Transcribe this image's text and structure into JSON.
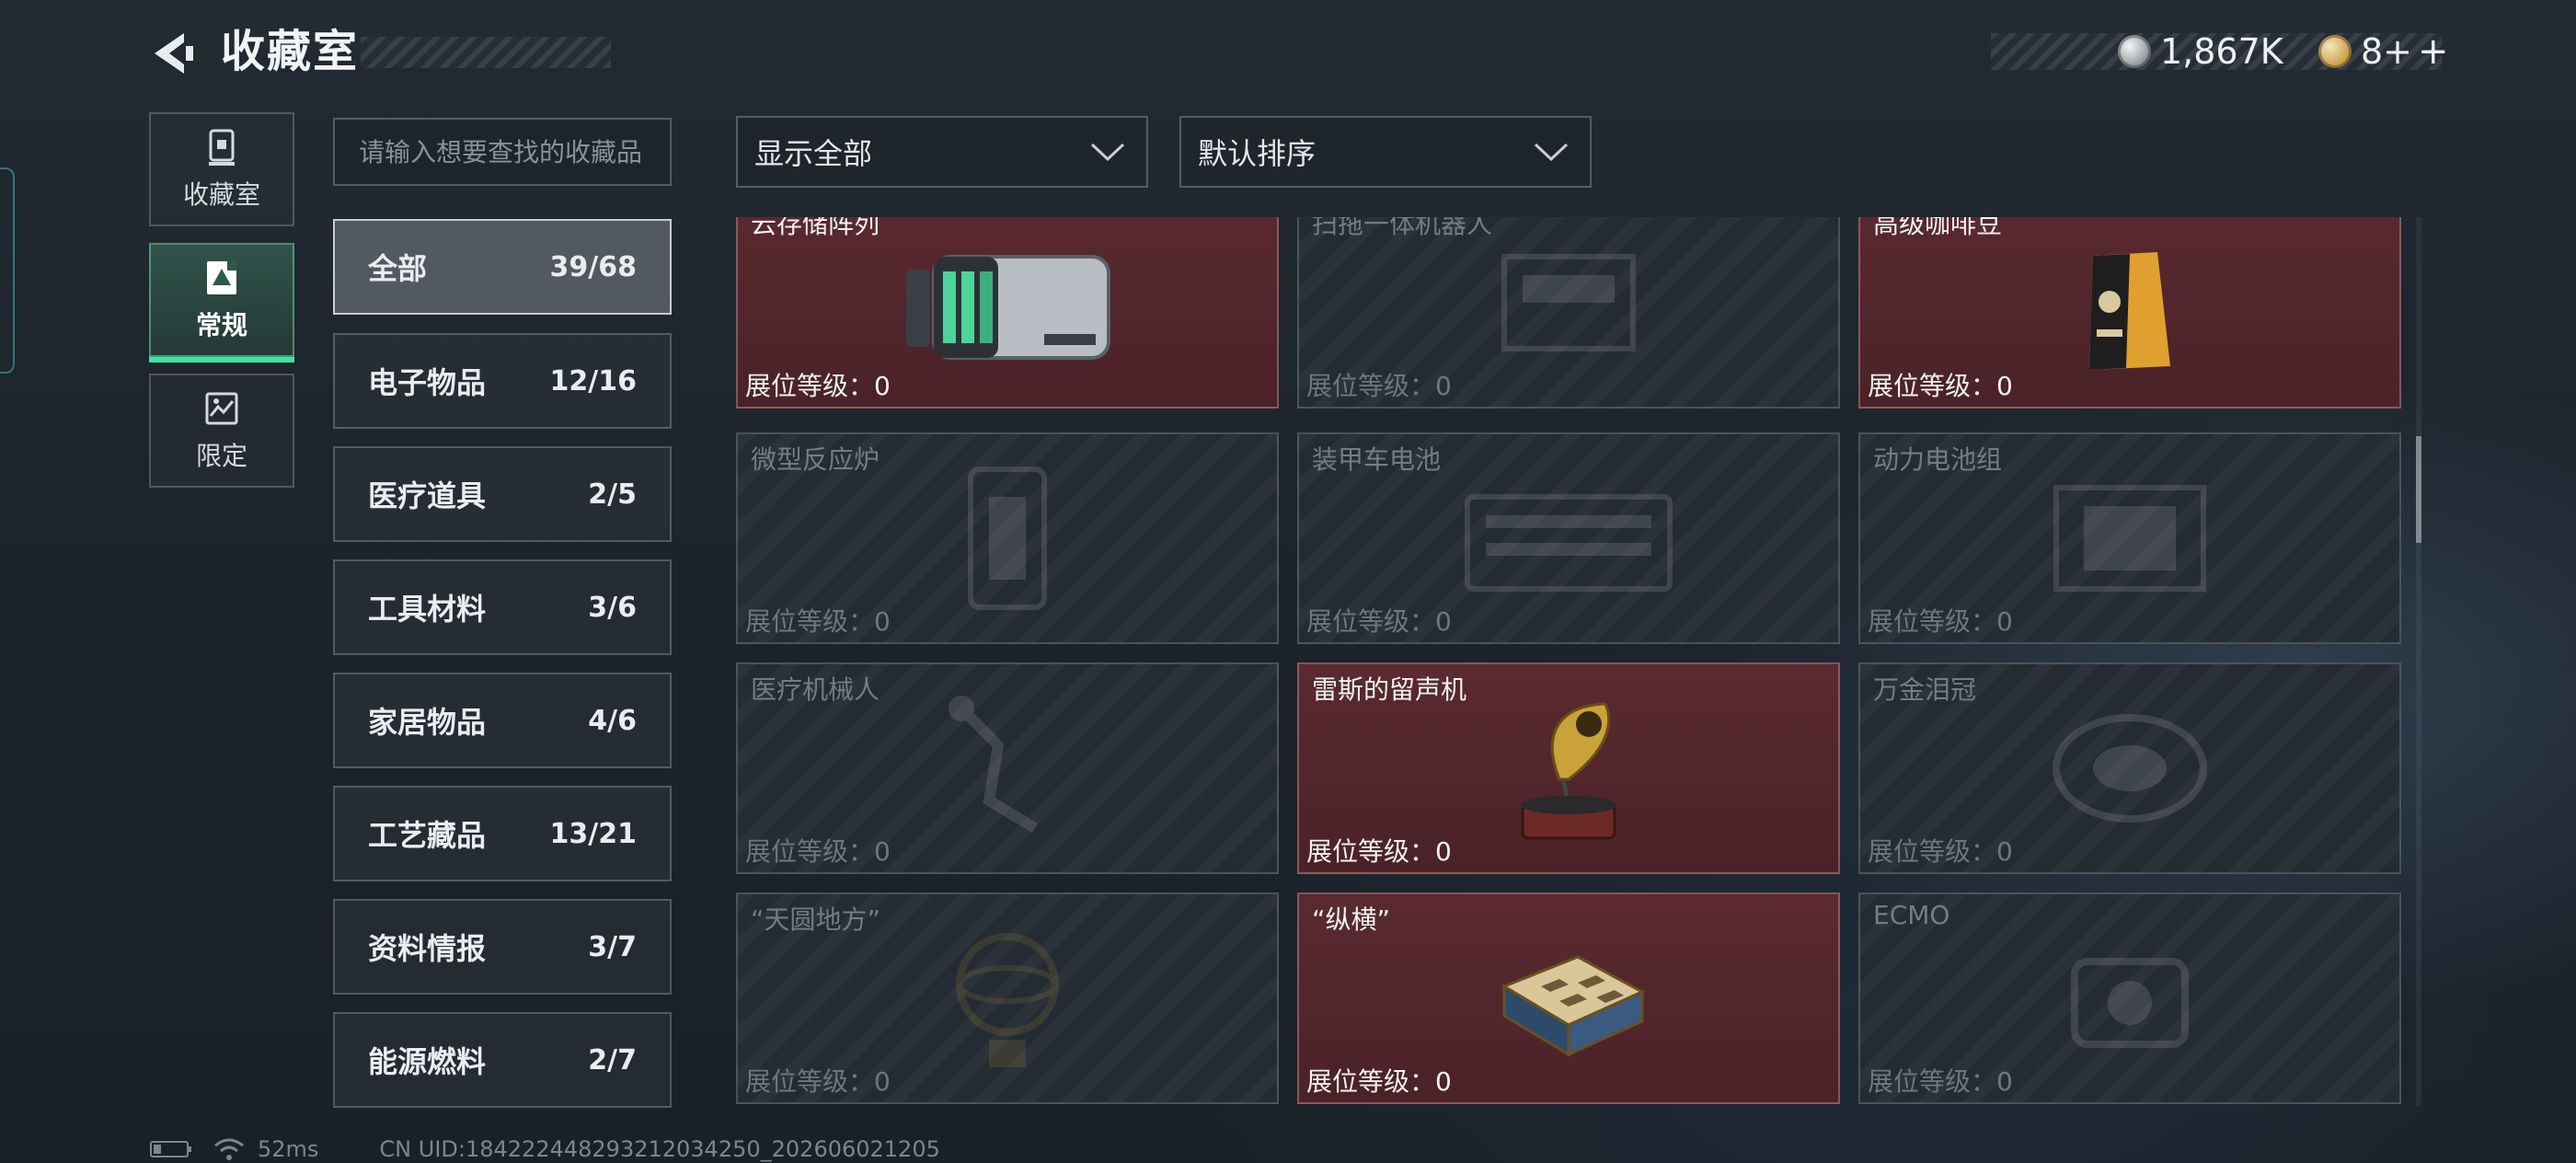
{
  "header": {
    "title": "收藏室"
  },
  "currency": {
    "silver": "1,867K",
    "gold": "8+"
  },
  "side_tabs": [
    {
      "label": "收藏室",
      "icon": "collection-room-icon"
    },
    {
      "label": "常规",
      "icon": "regular-collection-icon",
      "active": true
    },
    {
      "label": "限定",
      "icon": "limited-collection-icon"
    }
  ],
  "search": {
    "placeholder": "请输入想要查找的收藏品"
  },
  "categories": [
    {
      "name": "全部",
      "count": "39/68",
      "active": true
    },
    {
      "name": "电子物品",
      "count": "12/16"
    },
    {
      "name": "医疗道具",
      "count": "2/5"
    },
    {
      "name": "工具材料",
      "count": "3/6"
    },
    {
      "name": "家居物品",
      "count": "4/6"
    },
    {
      "name": "工艺藏品",
      "count": "13/21"
    },
    {
      "name": "资料情报",
      "count": "3/7"
    },
    {
      "name": "能源燃料",
      "count": "2/7"
    }
  ],
  "filters": {
    "show": "显示全部",
    "sort": "默认排序"
  },
  "items": [
    {
      "name": "云存储阵列",
      "level": "展位等级：0",
      "owned": true,
      "icon": "server-array-icon"
    },
    {
      "name": "扫拖一体机器人",
      "level": "展位等级：0",
      "owned": false,
      "icon": "robot-vacuum-icon"
    },
    {
      "name": "高级咖啡豆",
      "level": "展位等级：0",
      "owned": true,
      "icon": "coffee-bag-icon"
    },
    {
      "name": "微型反应炉",
      "level": "展位等级：0",
      "owned": false,
      "icon": "micro-reactor-icon"
    },
    {
      "name": "装甲车电池",
      "level": "展位等级：0",
      "owned": false,
      "icon": "armored-battery-icon"
    },
    {
      "name": "动力电池组",
      "level": "展位等级：0",
      "owned": false,
      "icon": "power-battery-icon"
    },
    {
      "name": "医疗机械人",
      "level": "展位等级：0",
      "owned": false,
      "icon": "medical-robot-icon"
    },
    {
      "name": "雷斯的留声机",
      "level": "展位等级：0",
      "owned": true,
      "icon": "gramophone-icon"
    },
    {
      "name": "万金泪冠",
      "level": "展位等级：0",
      "owned": false,
      "icon": "crown-icon"
    },
    {
      "name": "“天圆地方”",
      "level": "展位等级：0",
      "owned": false,
      "icon": "armillary-icon"
    },
    {
      "name": "“纵横”",
      "level": "展位等级：0",
      "owned": true,
      "icon": "chess-board-icon"
    },
    {
      "name": "ECMO",
      "level": "展位等级：0",
      "owned": false,
      "icon": "ecmo-icon"
    }
  ],
  "footer": {
    "ping": "52ms",
    "uid": "CN UID:184222448293212034250_202606021205"
  },
  "colors": {
    "owned_card": "#4f262c",
    "locked_card": "#242b33",
    "accent_green": "#3fe3a7"
  }
}
